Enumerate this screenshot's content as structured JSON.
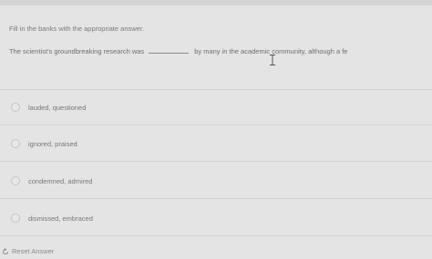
{
  "instruction": "Fill in the banks with the appropriate answer.",
  "question": {
    "before": "The scientist's groundbreaking research was",
    "after": "by many in the academic community, although a fe"
  },
  "options": [
    {
      "label": "lauded, questioned"
    },
    {
      "label": "ignored, praised"
    },
    {
      "label": "condemned, admired"
    },
    {
      "label": "dismissed, embraced"
    }
  ],
  "reset_label": "Reset Answer",
  "icons": {
    "cursor": "text-cursor-icon",
    "reset": "reset-arrow-icon",
    "radio": "radio-circle-icon"
  }
}
